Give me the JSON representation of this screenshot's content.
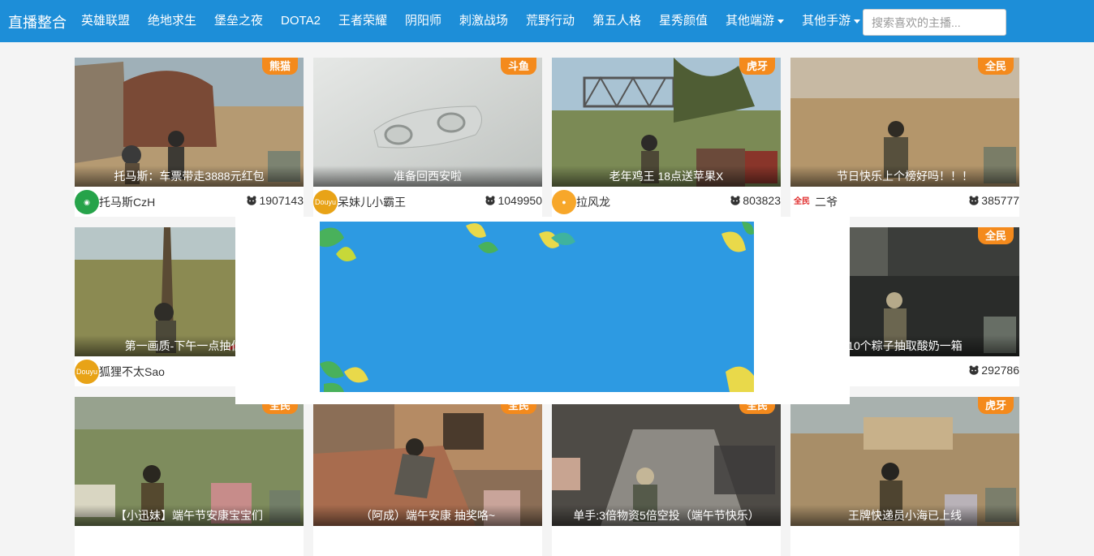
{
  "navbar": {
    "brand": "直播整合",
    "items": [
      {
        "label": "英雄联盟"
      },
      {
        "label": "绝地求生"
      },
      {
        "label": "堡垒之夜"
      },
      {
        "label": "DOTA2"
      },
      {
        "label": "王者荣耀"
      },
      {
        "label": "阴阳师"
      },
      {
        "label": "刺激战场"
      },
      {
        "label": "荒野行动"
      },
      {
        "label": "第五人格"
      },
      {
        "label": "星秀颜值"
      },
      {
        "label": "其他端游",
        "dropdown": true
      },
      {
        "label": "其他手游",
        "dropdown": true
      }
    ],
    "search_placeholder": "搜索喜欢的主播...",
    "background_color": "#1d8ed8"
  },
  "cards": [
    {
      "platform": "熊猫",
      "title": "托马斯：车票带走3888元红包",
      "streamer": "托马斯CzH",
      "viewers": "1907143",
      "avatar": "green-logo"
    },
    {
      "platform": "斗鱼",
      "title": "准备回西安啦",
      "streamer": "呆妹儿小霸王",
      "viewers": "1049950",
      "avatar": "douyu-logo"
    },
    {
      "platform": "虎牙",
      "title": "老年鸡王 18点送苹果X",
      "streamer": "拉风龙",
      "viewers": "803823",
      "avatar": "huya-logo"
    },
    {
      "platform": "全民",
      "title": "节日快乐上个榜好吗！！！",
      "streamer": "二爷",
      "viewers": "385777",
      "avatar": "quanmin-logo"
    },
    {
      "platform": "",
      "title": "第一画质-下午一点抽伯爽",
      "streamer": "狐狸不太Sao",
      "viewers": "",
      "avatar": "douyu-logo"
    },
    {
      "platform": "全民",
      "title": "10个粽子抽取酸奶一箱",
      "streamer": "",
      "viewers": "292786",
      "avatar": ""
    },
    {
      "platform": "全民",
      "title": "【小迅妹】端午节安康宝宝们",
      "streamer": "",
      "viewers": "",
      "avatar": ""
    },
    {
      "platform": "全民",
      "title": "（阿成）端午安康 抽奖咯~",
      "streamer": "",
      "viewers": "",
      "avatar": ""
    },
    {
      "platform": "全民",
      "title": "单手:3倍物资5倍空投（端午节快乐）",
      "streamer": "",
      "viewers": "",
      "avatar": ""
    },
    {
      "platform": "虎牙",
      "title": "王牌快递员小海已上线",
      "streamer": "",
      "viewers": "",
      "avatar": ""
    }
  ],
  "colors": {
    "badge": "#f48a1c",
    "popup_banner": "#2d9ae2"
  }
}
